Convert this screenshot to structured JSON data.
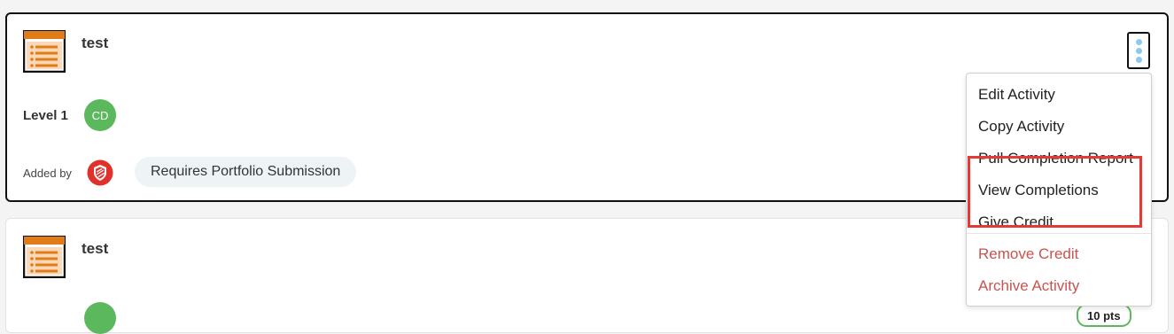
{
  "cards": [
    {
      "title": "test",
      "level_label": "Level 1",
      "avatar_initials": "CD",
      "added_by_label": "Added by",
      "tag": "Requires Portfolio Submission"
    },
    {
      "title": "test",
      "points": "10 pts"
    }
  ],
  "menu": {
    "items": [
      "Edit Activity",
      "Copy Activity",
      "Pull Completion Report",
      "View Completions",
      "Give Credit",
      "Remove Credit",
      "Archive Activity"
    ]
  },
  "colors": {
    "accent_orange": "#e07b1a",
    "avatar_green": "#5cb85c",
    "danger_red": "#c9534f",
    "highlight_red": "#e53935",
    "kebab_dot_blue": "#8ec8f0"
  },
  "icons": {
    "activity": "list-document-icon",
    "added_by": "red-shield-badge-icon",
    "menu": "kebab-menu-icon"
  }
}
